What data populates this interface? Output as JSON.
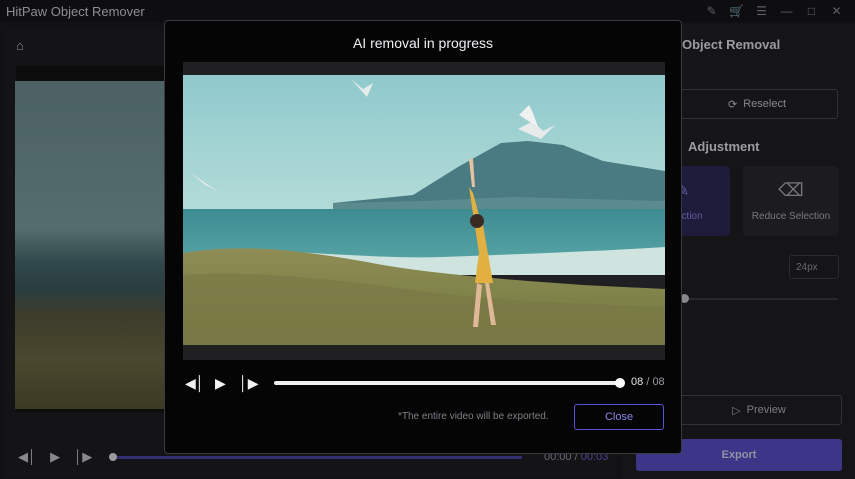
{
  "app": {
    "title": "HitPaw Object Remover"
  },
  "window_icons": [
    "brush-icon",
    "cart-icon",
    "menu-icon",
    "minimize-icon",
    "maximize-icon",
    "close-icon"
  ],
  "left": {
    "home_icon": "home-icon",
    "player": {
      "current_time": "00:00",
      "separator": "/",
      "duration": "00:03",
      "progress": 0.0
    }
  },
  "right_panel": {
    "title": "Object Removal",
    "reselect_label": "Reselect",
    "adjustment_title": "Adjustment",
    "add_selection_label": "Selection",
    "reduce_selection_label": "Reduce Selection",
    "brush_size": "24px",
    "brush_slider_level": 0.0,
    "preview_label": "Preview",
    "export_label": "Export"
  },
  "modal": {
    "title": "AI removal in progress",
    "current_frame": "08",
    "separator": "/",
    "total_frames": "08",
    "progress": 1.0,
    "note": "*The entire video will be exported.",
    "close_label": "Close"
  },
  "colors": {
    "accent": "#5a52d8",
    "background": "#1b1b1f",
    "modal_bg": "#050506"
  }
}
